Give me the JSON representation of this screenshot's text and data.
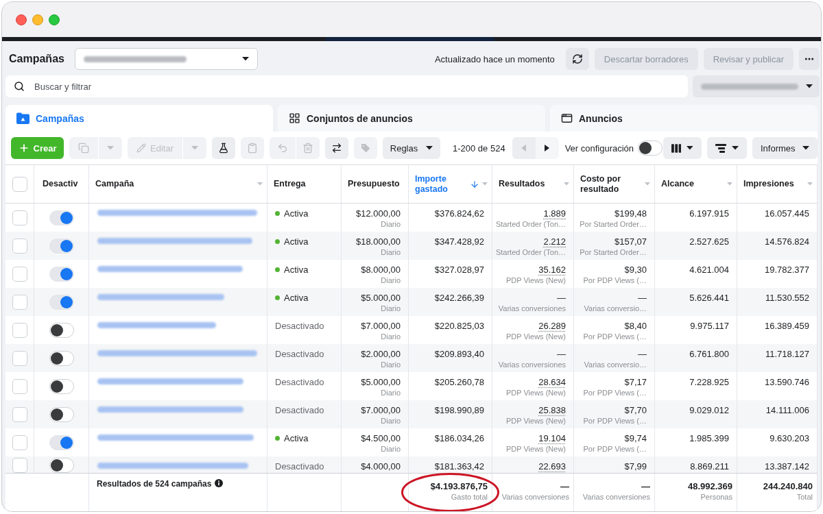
{
  "header": {
    "title": "Campañas",
    "updated_text": "Actualizado hace un momento",
    "buttons": [
      {
        "kind": "refresh",
        "disabled": false
      },
      {
        "kind": "text",
        "label": "Descartar borradores",
        "disabled": true
      },
      {
        "kind": "text",
        "label": "Revisar y publicar",
        "disabled": true
      },
      {
        "kind": "more",
        "disabled": false
      }
    ]
  },
  "search": {
    "placeholder": "Buscar y filtrar"
  },
  "tabs": [
    {
      "kind": "folder",
      "label": "Campañas",
      "selected": true
    },
    {
      "kind": "grid",
      "label": "Conjuntos de anuncios",
      "selected": false
    },
    {
      "kind": "window",
      "label": "Anuncios",
      "selected": false
    }
  ],
  "toolbar": {
    "action_groups": [
      [
        {
          "kind": "create",
          "label": "Crear",
          "disabled": false
        }
      ],
      [
        {
          "kind": "duplicate",
          "disabled": true
        },
        {
          "kind": "menu",
          "disabled": true
        }
      ],
      [
        {
          "kind": "edit",
          "label": "Editar",
          "disabled": true
        },
        {
          "kind": "menu",
          "disabled": true
        }
      ],
      [
        {
          "kind": "flask",
          "disabled": false
        }
      ],
      [
        {
          "kind": "clipboard",
          "disabled": true
        }
      ],
      [
        {
          "kind": "undo",
          "disabled": true
        },
        {
          "kind": "trash",
          "disabled": true
        }
      ],
      [
        {
          "kind": "swap",
          "disabled": false
        }
      ],
      [
        {
          "kind": "tag",
          "disabled": true
        }
      ],
      [
        {
          "kind": "dropdown",
          "label": "Reglas",
          "disabled": false
        }
      ]
    ],
    "pagination": {
      "text": "1-200 de 524",
      "prev": {
        "disabled": true
      },
      "next": {
        "disabled": false
      }
    },
    "settings_toggle": {
      "label": "Ver configuración",
      "on": false
    },
    "view_buttons": [
      {
        "kind": "columns"
      },
      {
        "kind": "breakdown"
      },
      {
        "kind": "dropdown",
        "label": "Informes"
      }
    ]
  },
  "table": {
    "header_checkbox": {
      "checked": false
    },
    "columns": [
      {
        "label": "Desactiv",
        "sorted": false,
        "menu": false
      },
      {
        "label": "Campaña",
        "sorted": false,
        "menu": true
      },
      {
        "label": "Entrega",
        "sorted": false,
        "menu": false
      },
      {
        "label": "Presupuesto",
        "sorted": false,
        "menu": false
      },
      {
        "label": "Importe gastado",
        "sorted": true,
        "menu": true
      },
      {
        "label": "Resultados",
        "sorted": false,
        "menu": true
      },
      {
        "label": "Costo por resultado",
        "sorted": false,
        "menu": true
      },
      {
        "label": "Alcance",
        "sorted": false,
        "menu": true
      },
      {
        "label": "Impresiones",
        "sorted": false,
        "menu": true
      }
    ],
    "rows": [
      {
        "checked": false,
        "on": true,
        "delivery": {
          "label": "Activa",
          "active": true
        },
        "budget": {
          "value": "$12.000,00",
          "period": "Diario"
        },
        "spent": "$376.824,62",
        "results": {
          "value": "1.889",
          "label": "Started Order (Ton…",
          "underlined": true
        },
        "cost": {
          "value": "$199,48",
          "label": "Por Started Order…"
        },
        "reach": "6.197.915",
        "impressions": "16.057.445"
      },
      {
        "checked": false,
        "on": true,
        "delivery": {
          "label": "Activa",
          "active": true
        },
        "budget": {
          "value": "$18.000,00",
          "period": "Diario"
        },
        "spent": "$347.428,92",
        "results": {
          "value": "2.212",
          "label": "Started Order (Ton…",
          "underlined": true
        },
        "cost": {
          "value": "$157,07",
          "label": "Por Started Order…"
        },
        "reach": "2.527.625",
        "impressions": "14.576.824"
      },
      {
        "checked": false,
        "on": true,
        "delivery": {
          "label": "Activa",
          "active": true
        },
        "budget": {
          "value": "$8.000,00",
          "period": "Diario"
        },
        "spent": "$327.028,97",
        "results": {
          "value": "35.162",
          "label": "PDP Views (New)",
          "underlined": true
        },
        "cost": {
          "value": "$9,30",
          "label": "Por PDP Views (…"
        },
        "reach": "4.621.004",
        "impressions": "19.782.377"
      },
      {
        "checked": false,
        "on": true,
        "delivery": {
          "label": "Activa",
          "active": true
        },
        "budget": {
          "value": "$5.000,00",
          "period": "Diario"
        },
        "spent": "$242.266,39",
        "results": {
          "value": "—",
          "label": "Varias conversiones",
          "underlined": false
        },
        "cost": {
          "value": "—",
          "label": "Varias conversio…"
        },
        "reach": "5.626.441",
        "impressions": "11.530.552"
      },
      {
        "checked": false,
        "on": false,
        "delivery": {
          "label": "Desactivado",
          "active": false
        },
        "budget": {
          "value": "$7.000,00",
          "period": "Diario"
        },
        "spent": "$220.825,03",
        "results": {
          "value": "26.289",
          "label": "PDP Views (New)",
          "underlined": true
        },
        "cost": {
          "value": "$8,40",
          "label": "Por PDP Views (…"
        },
        "reach": "9.975.117",
        "impressions": "16.389.459"
      },
      {
        "checked": false,
        "on": false,
        "delivery": {
          "label": "Desactivado",
          "active": false
        },
        "budget": {
          "value": "$2.000,00",
          "period": "Diario"
        },
        "spent": "$209.893,40",
        "results": {
          "value": "—",
          "label": "Varias conversiones",
          "underlined": false
        },
        "cost": {
          "value": "—",
          "label": "Varias conversio…"
        },
        "reach": "6.761.800",
        "impressions": "11.718.127"
      },
      {
        "checked": false,
        "on": false,
        "delivery": {
          "label": "Desactivado",
          "active": false
        },
        "budget": {
          "value": "$5.000,00",
          "period": "Diario"
        },
        "spent": "$205.260,78",
        "results": {
          "value": "28.634",
          "label": "PDP Views (New)",
          "underlined": true
        },
        "cost": {
          "value": "$7,17",
          "label": "Por PDP Views (…"
        },
        "reach": "7.228.925",
        "impressions": "13.590.746"
      },
      {
        "checked": false,
        "on": false,
        "delivery": {
          "label": "Desactivado",
          "active": false
        },
        "budget": {
          "value": "$7.000,00",
          "period": "Diario"
        },
        "spent": "$198.990,89",
        "results": {
          "value": "25.838",
          "label": "PDP Views (New)",
          "underlined": true
        },
        "cost": {
          "value": "$7,70",
          "label": "Por PDP Views (…"
        },
        "reach": "9.029.012",
        "impressions": "14.111.006"
      },
      {
        "checked": false,
        "on": true,
        "delivery": {
          "label": "Activa",
          "active": true
        },
        "budget": {
          "value": "$4.500,00",
          "period": "Diario"
        },
        "spent": "$186.034,26",
        "results": {
          "value": "19.104",
          "label": "PDP Views (New)",
          "underlined": true
        },
        "cost": {
          "value": "$9,74",
          "label": "Por PDP Views (…"
        },
        "reach": "1.985.399",
        "impressions": "9.630.203"
      },
      {
        "checked": false,
        "on": false,
        "delivery": {
          "label": "Desactivado",
          "active": false
        },
        "budget": {
          "value": "$4.000,00"
        },
        "spent": "$181.363,42",
        "results": {
          "value": "22.693",
          "underlined": true
        },
        "cost": {
          "value": "$7,99"
        },
        "reach": "8.869.211",
        "impressions": "13.387.142"
      }
    ],
    "summary": {
      "label": "Resultados de 524 campañas",
      "spent": {
        "value": "$4.193.876,75",
        "label": "Gasto total",
        "circled": true
      },
      "results": {
        "value": "—",
        "label": "Varias conversiones"
      },
      "cost": {
        "value": "—",
        "label": "Varias conversiones"
      },
      "reach": {
        "value": "48.992.369",
        "label": "Personas"
      },
      "impressions": {
        "value": "244.240.840",
        "label": "Total"
      }
    }
  }
}
